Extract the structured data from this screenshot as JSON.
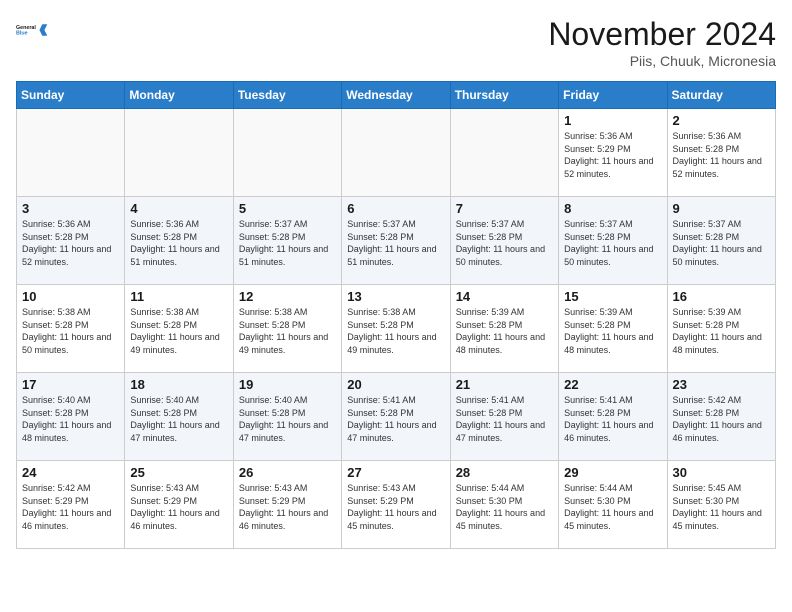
{
  "header": {
    "logo_line1": "General",
    "logo_line2": "Blue",
    "month_title": "November 2024",
    "location": "Piis, Chuuk, Micronesia"
  },
  "weekdays": [
    "Sunday",
    "Monday",
    "Tuesday",
    "Wednesday",
    "Thursday",
    "Friday",
    "Saturday"
  ],
  "weeks": [
    [
      {
        "day": "",
        "info": ""
      },
      {
        "day": "",
        "info": ""
      },
      {
        "day": "",
        "info": ""
      },
      {
        "day": "",
        "info": ""
      },
      {
        "day": "",
        "info": ""
      },
      {
        "day": "1",
        "info": "Sunrise: 5:36 AM\nSunset: 5:29 PM\nDaylight: 11 hours and 52 minutes."
      },
      {
        "day": "2",
        "info": "Sunrise: 5:36 AM\nSunset: 5:28 PM\nDaylight: 11 hours and 52 minutes."
      }
    ],
    [
      {
        "day": "3",
        "info": "Sunrise: 5:36 AM\nSunset: 5:28 PM\nDaylight: 11 hours and 52 minutes."
      },
      {
        "day": "4",
        "info": "Sunrise: 5:36 AM\nSunset: 5:28 PM\nDaylight: 11 hours and 51 minutes."
      },
      {
        "day": "5",
        "info": "Sunrise: 5:37 AM\nSunset: 5:28 PM\nDaylight: 11 hours and 51 minutes."
      },
      {
        "day": "6",
        "info": "Sunrise: 5:37 AM\nSunset: 5:28 PM\nDaylight: 11 hours and 51 minutes."
      },
      {
        "day": "7",
        "info": "Sunrise: 5:37 AM\nSunset: 5:28 PM\nDaylight: 11 hours and 50 minutes."
      },
      {
        "day": "8",
        "info": "Sunrise: 5:37 AM\nSunset: 5:28 PM\nDaylight: 11 hours and 50 minutes."
      },
      {
        "day": "9",
        "info": "Sunrise: 5:37 AM\nSunset: 5:28 PM\nDaylight: 11 hours and 50 minutes."
      }
    ],
    [
      {
        "day": "10",
        "info": "Sunrise: 5:38 AM\nSunset: 5:28 PM\nDaylight: 11 hours and 50 minutes."
      },
      {
        "day": "11",
        "info": "Sunrise: 5:38 AM\nSunset: 5:28 PM\nDaylight: 11 hours and 49 minutes."
      },
      {
        "day": "12",
        "info": "Sunrise: 5:38 AM\nSunset: 5:28 PM\nDaylight: 11 hours and 49 minutes."
      },
      {
        "day": "13",
        "info": "Sunrise: 5:38 AM\nSunset: 5:28 PM\nDaylight: 11 hours and 49 minutes."
      },
      {
        "day": "14",
        "info": "Sunrise: 5:39 AM\nSunset: 5:28 PM\nDaylight: 11 hours and 48 minutes."
      },
      {
        "day": "15",
        "info": "Sunrise: 5:39 AM\nSunset: 5:28 PM\nDaylight: 11 hours and 48 minutes."
      },
      {
        "day": "16",
        "info": "Sunrise: 5:39 AM\nSunset: 5:28 PM\nDaylight: 11 hours and 48 minutes."
      }
    ],
    [
      {
        "day": "17",
        "info": "Sunrise: 5:40 AM\nSunset: 5:28 PM\nDaylight: 11 hours and 48 minutes."
      },
      {
        "day": "18",
        "info": "Sunrise: 5:40 AM\nSunset: 5:28 PM\nDaylight: 11 hours and 47 minutes."
      },
      {
        "day": "19",
        "info": "Sunrise: 5:40 AM\nSunset: 5:28 PM\nDaylight: 11 hours and 47 minutes."
      },
      {
        "day": "20",
        "info": "Sunrise: 5:41 AM\nSunset: 5:28 PM\nDaylight: 11 hours and 47 minutes."
      },
      {
        "day": "21",
        "info": "Sunrise: 5:41 AM\nSunset: 5:28 PM\nDaylight: 11 hours and 47 minutes."
      },
      {
        "day": "22",
        "info": "Sunrise: 5:41 AM\nSunset: 5:28 PM\nDaylight: 11 hours and 46 minutes."
      },
      {
        "day": "23",
        "info": "Sunrise: 5:42 AM\nSunset: 5:28 PM\nDaylight: 11 hours and 46 minutes."
      }
    ],
    [
      {
        "day": "24",
        "info": "Sunrise: 5:42 AM\nSunset: 5:29 PM\nDaylight: 11 hours and 46 minutes."
      },
      {
        "day": "25",
        "info": "Sunrise: 5:43 AM\nSunset: 5:29 PM\nDaylight: 11 hours and 46 minutes."
      },
      {
        "day": "26",
        "info": "Sunrise: 5:43 AM\nSunset: 5:29 PM\nDaylight: 11 hours and 46 minutes."
      },
      {
        "day": "27",
        "info": "Sunrise: 5:43 AM\nSunset: 5:29 PM\nDaylight: 11 hours and 45 minutes."
      },
      {
        "day": "28",
        "info": "Sunrise: 5:44 AM\nSunset: 5:30 PM\nDaylight: 11 hours and 45 minutes."
      },
      {
        "day": "29",
        "info": "Sunrise: 5:44 AM\nSunset: 5:30 PM\nDaylight: 11 hours and 45 minutes."
      },
      {
        "day": "30",
        "info": "Sunrise: 5:45 AM\nSunset: 5:30 PM\nDaylight: 11 hours and 45 minutes."
      }
    ]
  ]
}
